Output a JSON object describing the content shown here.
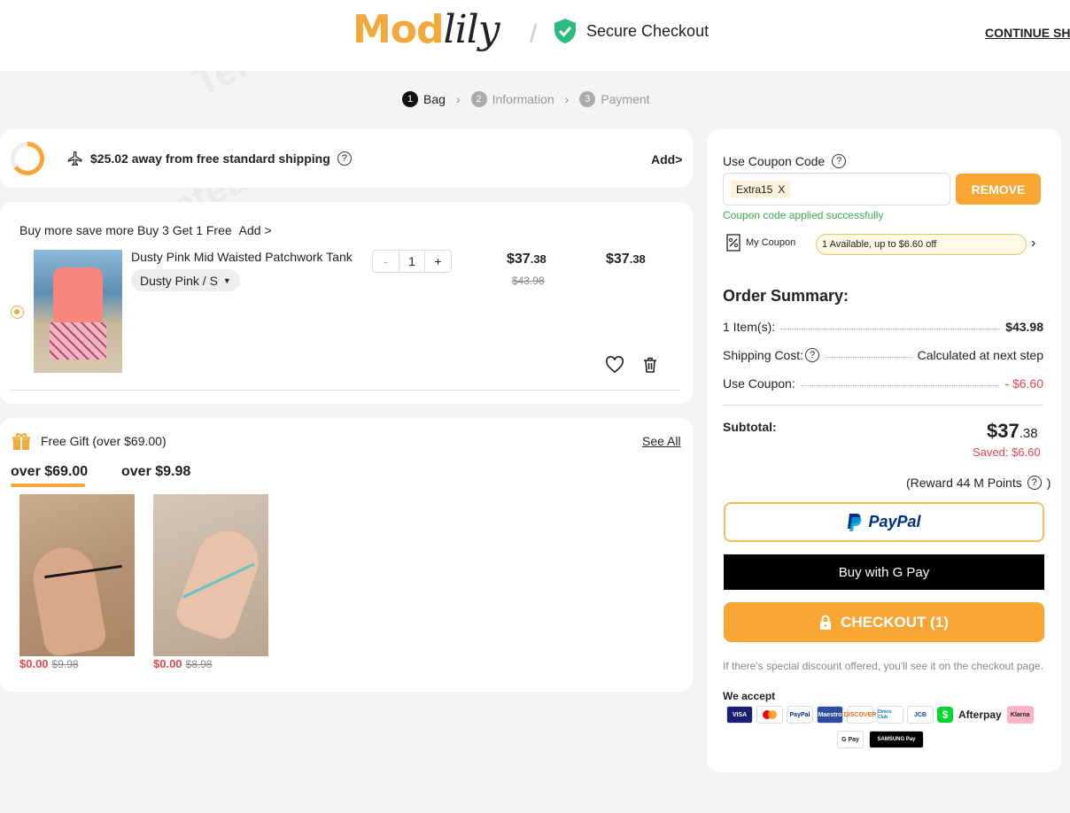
{
  "header": {
    "logo_part1": "Mod",
    "logo_part2": "lily",
    "secure_label": "Secure Checkout",
    "continue_link": "CONTINUE SHOPPING"
  },
  "steps": [
    {
      "num": "1",
      "label": "Bag"
    },
    {
      "num": "2",
      "label": "Information"
    },
    {
      "num": "3",
      "label": "Payment"
    }
  ],
  "shipping_bar": {
    "text": "$25.02 away from free standard shipping",
    "add_label": "Add>",
    "progress": 0.65
  },
  "cart": {
    "promo_text": "Buy more save more Buy 3 Get 1 Free",
    "promo_add": "Add >",
    "item": {
      "name": "Dusty Pink Mid Waisted Patchwork Tank Top and Shorts Swim Set",
      "variant": "Dusty Pink / S",
      "qty_minus": "-",
      "qty": "1",
      "qty_plus": "+",
      "price_main": "$37",
      "price_cents": ".38",
      "original_price": "$43.98",
      "total_main": "$37",
      "total_cents": ".38"
    }
  },
  "gift": {
    "title": "Free Gift (over $69.00)",
    "see_all": "See All",
    "tabs": [
      "over $69.00",
      "over $9.98"
    ],
    "items": [
      {
        "price": "$0.00",
        "original": "$9.98"
      },
      {
        "price": "$0.00",
        "original": "$8.98"
      }
    ]
  },
  "coupon": {
    "label": "Use Coupon Code",
    "code": "Extra15",
    "chip_close": "X",
    "remove": "REMOVE",
    "applied_msg": "Coupon code applied successfully",
    "my_coupon": "My Coupon",
    "available": "1 Available, up to $6.60 off"
  },
  "summary": {
    "title": "Order Summary:",
    "items_label": "1 Item(s):",
    "items_value": "$43.98",
    "shipping_label": "Shipping Cost:",
    "shipping_value": "Calculated at next step",
    "coupon_label": "Use Coupon:",
    "coupon_value": "- $6.60",
    "subtotal_label": "Subtotal:",
    "subtotal_main": "$37",
    "subtotal_cents": ".38",
    "saved": "Saved: $6.60",
    "reward": "(Reward 44 M Points"
  },
  "buttons": {
    "paypal": "PayPal",
    "gpay": "Buy with G Pay",
    "checkout": "CHECKOUT (1)"
  },
  "footer": {
    "discount_note": "If there's special discount offered, you'll see it on the checkout page.",
    "we_accept": "We accept",
    "payment_methods": [
      "VISA",
      "mastercard",
      "PayPal",
      "Maestro",
      "DISCOVER",
      "Diners Club",
      "JCB",
      "$",
      "Afterpay",
      "Klarna",
      "G Pay",
      "SAMSUNG Pay"
    ]
  },
  "colors": {
    "accent": "#f9a635",
    "price_red": "#e4474a",
    "success_green": "#3bab4c",
    "paypal_blue": "#003087"
  }
}
